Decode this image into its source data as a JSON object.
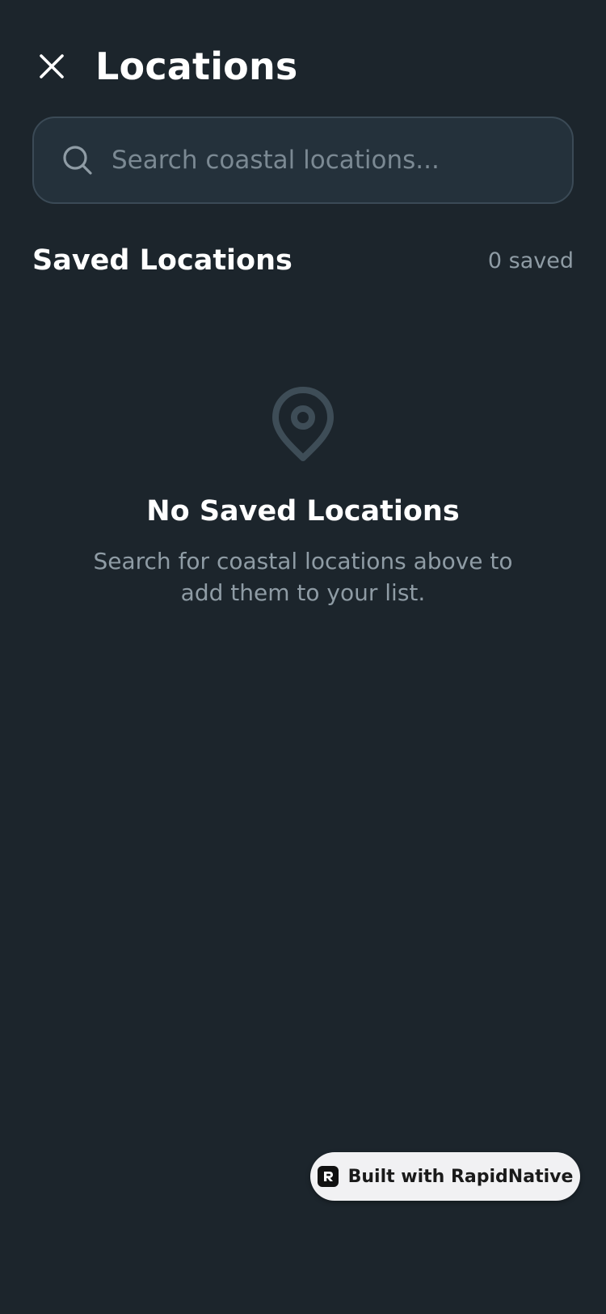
{
  "colors": {
    "background": "#1c252c",
    "search_background": "#24313b",
    "search_border": "#3b4a56",
    "muted_text": "#8f9ca5",
    "icon_muted": "#3e4d57",
    "badge_background": "#f1f1f3"
  },
  "header": {
    "close_icon": "close-icon",
    "title": "Locations"
  },
  "search": {
    "icon": "search-icon",
    "value": "",
    "placeholder": "Search coastal locations..."
  },
  "saved_section": {
    "title": "Saved Locations",
    "count_label": "0 saved"
  },
  "empty_state": {
    "icon": "map-pin-icon",
    "title": "No Saved Locations",
    "description": "Search for coastal locations above to add them to your list."
  },
  "badge": {
    "logo_icon": "rapidnative-logo-icon",
    "label": "Built with RapidNative"
  }
}
